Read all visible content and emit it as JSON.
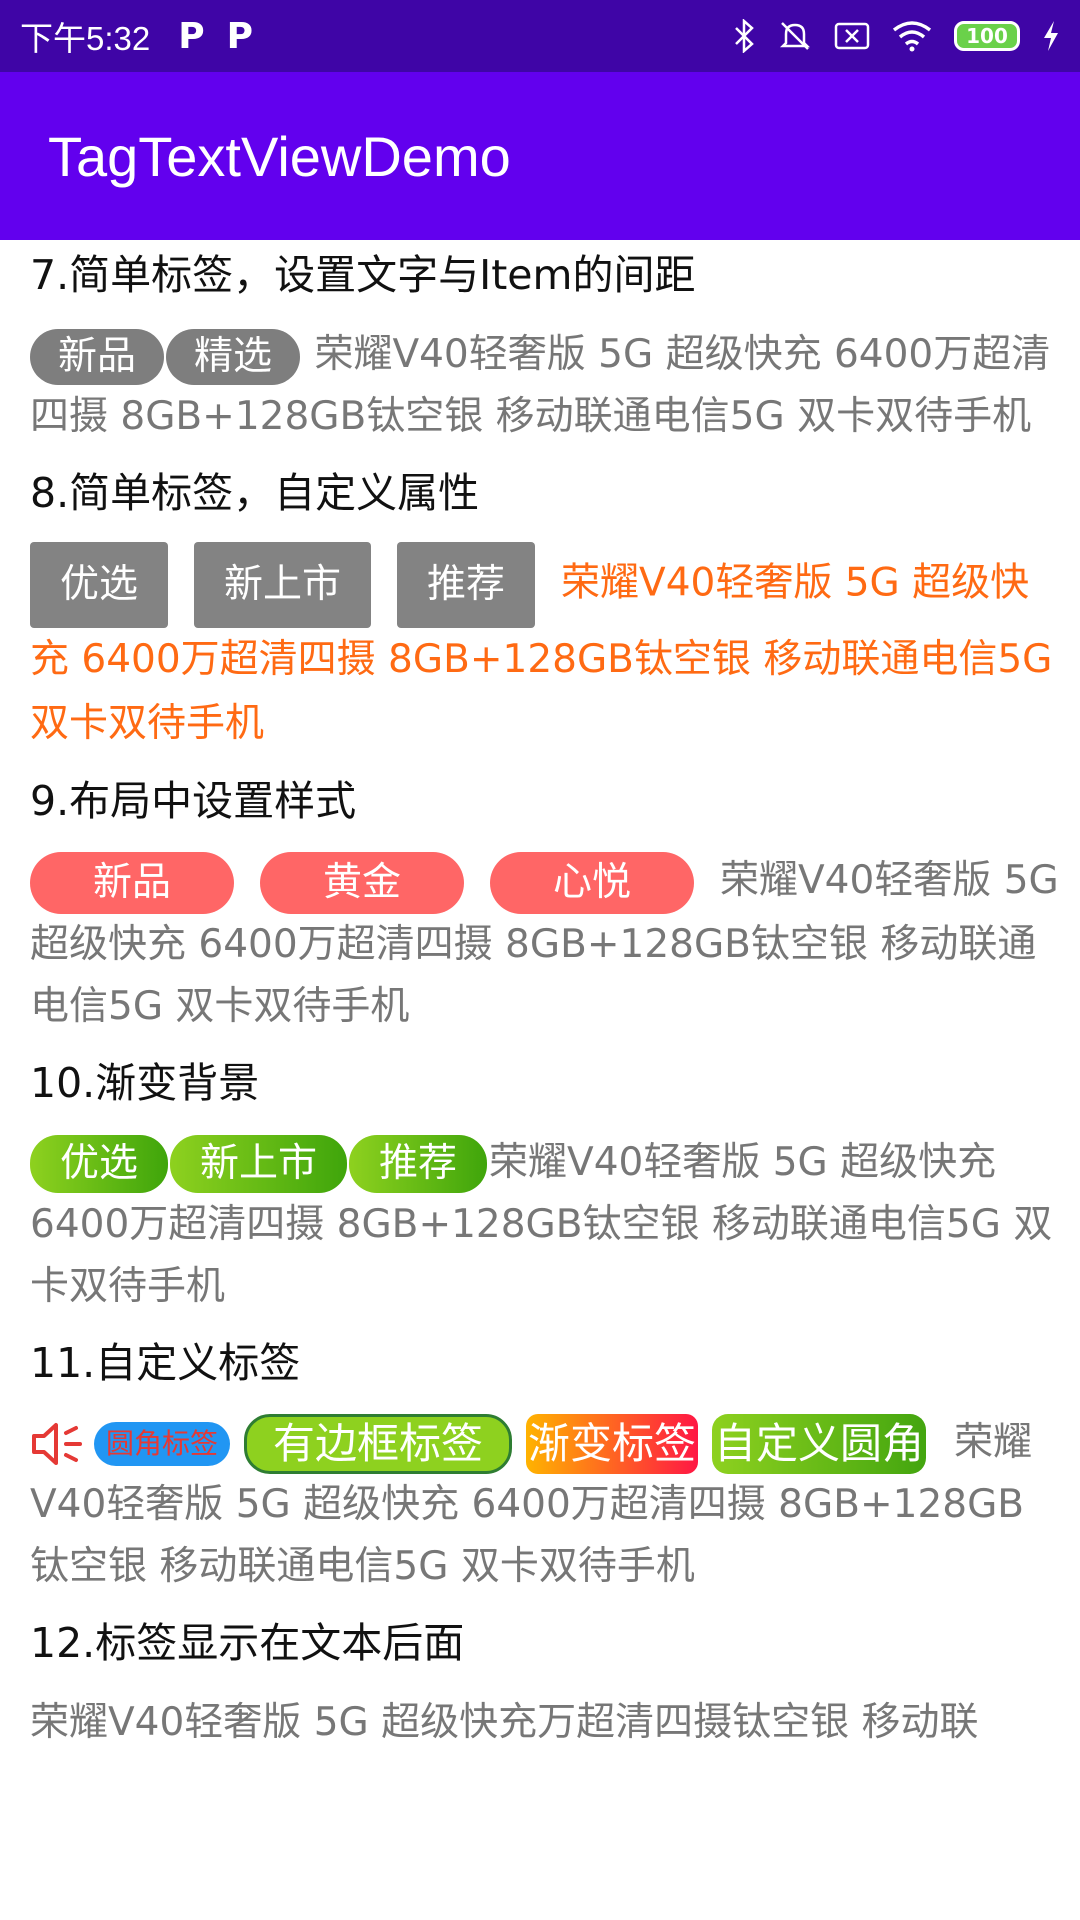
{
  "status_bar": {
    "time": "下午5:32",
    "icons": [
      "parking-icon",
      "parking-icon",
      "bluetooth-icon",
      "mute-icon",
      "sim-icon",
      "wifi-icon",
      "battery-icon",
      "charging-icon"
    ],
    "battery": "100"
  },
  "app_bar": {
    "title": "TagTextViewDemo"
  },
  "product_text": "荣耀V40轻奢版 5G 超级快充 6400万超清四摄 8GB+128GB钛空银 移动联通电信5G 双卡双待手机",
  "sections": [
    {
      "title": "7.简单标签，设置文字与Item的间距",
      "tags": [
        "新品",
        "精选"
      ]
    },
    {
      "title": "8.简单标签，自定义属性",
      "tags": [
        "优选",
        "新上市",
        "推荐"
      ],
      "text_color": "#ff6a13"
    },
    {
      "title": "9.布局中设置样式",
      "tags": [
        "新品",
        "黄金",
        "心悦"
      ]
    },
    {
      "title": "10.渐变背景",
      "tags": [
        "优选",
        "新上市",
        "推荐"
      ]
    },
    {
      "title": "11.自定义标签",
      "tags": [
        "圆角标签",
        "有边框标签",
        "渐变标签",
        "自定义圆角"
      ]
    },
    {
      "title": "12.标签显示在文本后面",
      "text": "荣耀V40轻奢版 5G 超级快充万超清四摄钛空银 移动联"
    }
  ],
  "colors": {
    "status_bar": "#3f05a6",
    "app_bar": "#6200ee",
    "gray_tag": "#7e7e7e",
    "red_tag": "#ff6666",
    "green_gradient": [
      "#8ed11f",
      "#3fa50b"
    ],
    "orange_gradient": [
      "#ffb300",
      "#ff1744"
    ],
    "speaker_icon": "#e53935"
  }
}
